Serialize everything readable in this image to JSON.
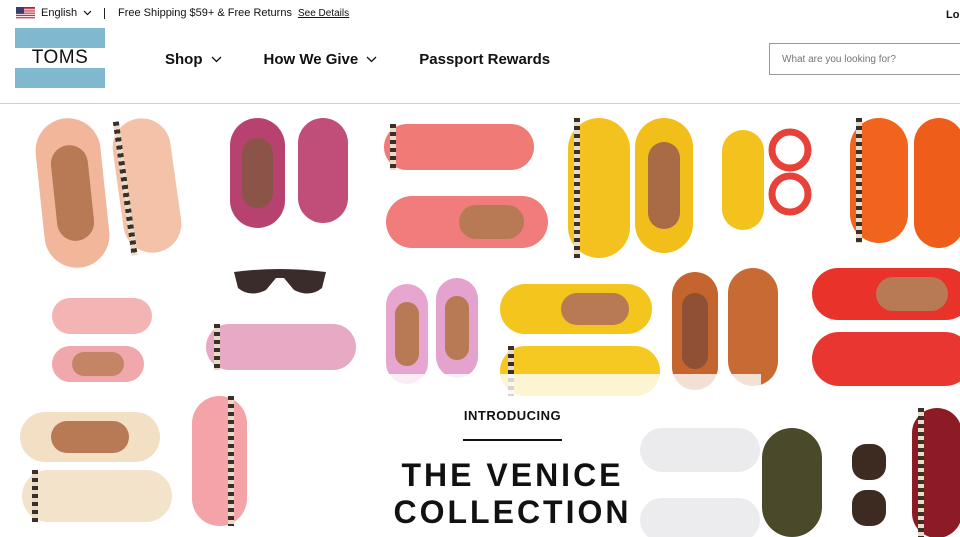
{
  "topbar": {
    "language": "English",
    "flag_icon": "us-flag-icon",
    "promo_text": "Free Shipping $59+ & Free Returns",
    "promo_link": "See Details",
    "login": "Log"
  },
  "header": {
    "logo_text": "TOMS",
    "logo_color": "#7fb8cf",
    "nav": [
      {
        "label": "Shop",
        "has_dropdown": true
      },
      {
        "label": "How We Give",
        "has_dropdown": true
      },
      {
        "label": "Passport Rewards",
        "has_dropdown": false
      }
    ],
    "search_placeholder": "What are you looking for?"
  },
  "hero": {
    "eyebrow": "INTRODUCING",
    "title": "THE VENICE\nCOLLECTION"
  }
}
